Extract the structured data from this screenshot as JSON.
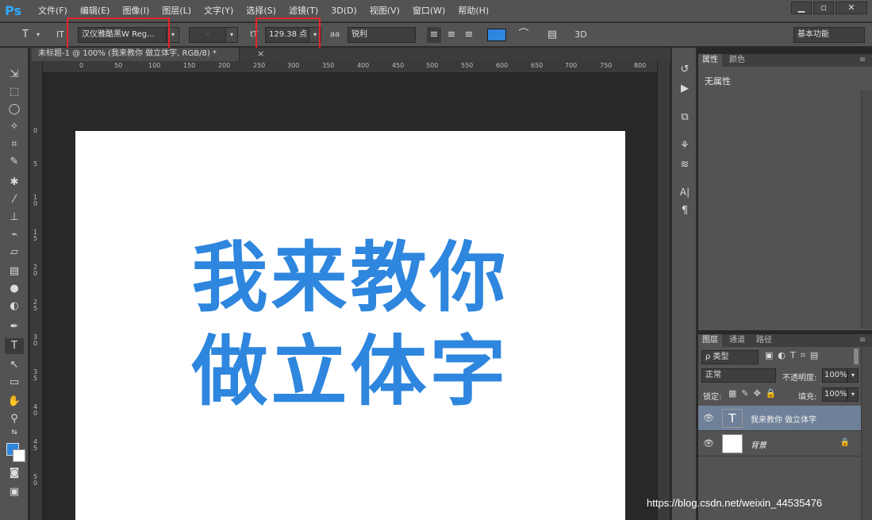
{
  "app": {
    "logo": "Ps"
  },
  "menu": [
    "文件(F)",
    "编辑(E)",
    "图像(I)",
    "图层(L)",
    "文字(Y)",
    "选择(S)",
    "滤镜(T)",
    "3D(D)",
    "视图(V)",
    "窗口(W)",
    "帮助(H)"
  ],
  "window_controls": {
    "minimize": "▁",
    "maximize": "▫",
    "close": "✕"
  },
  "options": {
    "tool_glyph": "T",
    "orient_glyph": "IT",
    "font_family": "汉仪雅酷黑W Reg...",
    "font_style": "-",
    "size_glyph": "tT",
    "font_size": "129.38 点",
    "aa_glyph": "aa",
    "antialias": "锐利",
    "align_left": "≡",
    "align_center": "≡",
    "align_right": "≡",
    "text_color": "#2e86de",
    "warp_glyph": "⌒",
    "panel_glyph": "▤",
    "threeD": "3D",
    "workspace": "基本功能"
  },
  "document": {
    "tab_title": "未标题-1 @ 100% (我来教你 做立体字, RGB/8) *",
    "close": "×",
    "line1": "我来教你",
    "line2": "做立体字"
  },
  "ruler": {
    "h_labels": [
      "0",
      "50",
      "100",
      "150",
      "200",
      "250",
      "300",
      "350",
      "400",
      "450",
      "500",
      "550",
      "600",
      "650",
      "700",
      "750",
      "800"
    ],
    "v_labels": [
      "0",
      "5",
      "10",
      "15",
      "20",
      "25",
      "30",
      "35",
      "40",
      "45",
      "50"
    ]
  },
  "properties": {
    "tabs": [
      "属性",
      "颜色"
    ],
    "empty_text": "无属性"
  },
  "layers": {
    "tabs": [
      "图层",
      "通道",
      "路径"
    ],
    "filter_kind": "ρ 类型",
    "blend_mode": "正常",
    "opacity_label": "不透明度:",
    "opacity_value": "100%",
    "lock_label": "锁定:",
    "fill_label": "填充:",
    "fill_value": "100%",
    "items": [
      {
        "name": "我来教你 做立体字",
        "thumb": "T"
      },
      {
        "name": "背景",
        "thumb": ""
      }
    ]
  },
  "watermark": "https://blog.csdn.net/weixin_44535476"
}
